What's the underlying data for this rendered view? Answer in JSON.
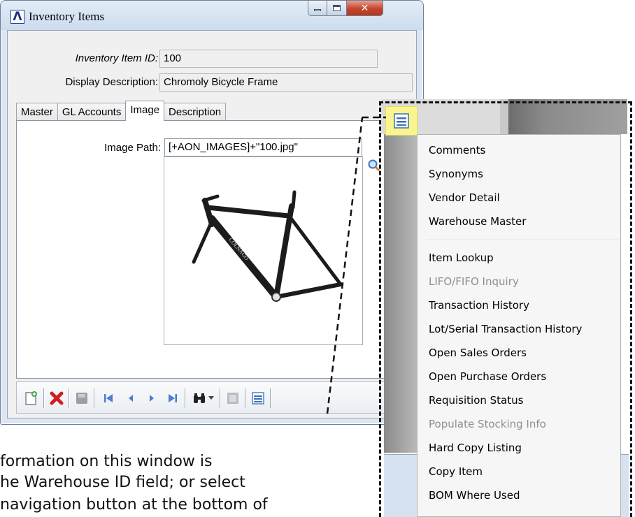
{
  "window": {
    "title": "Inventory Items",
    "app_icon_glyph": "Λ"
  },
  "form": {
    "item_id_label": "Inventory Item ID:",
    "item_id_value": "100",
    "description_label": "Display Description:",
    "description_value": "Chromoly Bicycle Frame"
  },
  "tabs": [
    {
      "label": "Master"
    },
    {
      "label": "GL Accounts"
    },
    {
      "label": "Image",
      "active": true
    },
    {
      "label": "Description"
    }
  ],
  "image_tab": {
    "path_label": "Image Path:",
    "path_value": "[+AON_IMAGES]+\"100.jpg\"",
    "frame_brand": "COLNAGO"
  },
  "toolbar": {
    "buttons": [
      "new-record-icon",
      "delete-icon",
      "save-icon",
      "first-record-icon",
      "previous-record-icon",
      "next-record-icon",
      "last-record-icon",
      "find-binoculars-icon",
      "dropdown-arrow-icon",
      "disabled-icon",
      "additional-options-icon"
    ]
  },
  "menu": {
    "items": [
      {
        "label": "Comments",
        "disabled": false
      },
      {
        "label": "Synonyms",
        "disabled": false
      },
      {
        "label": "Vendor Detail",
        "disabled": false
      },
      {
        "label": "Warehouse Master",
        "disabled": false
      },
      {
        "label": "Item Lookup",
        "disabled": false
      },
      {
        "label": "LIFO/FIFO Inquiry",
        "disabled": true
      },
      {
        "label": "Transaction History",
        "disabled": false
      },
      {
        "label": "Lot/Serial Transaction History",
        "disabled": false
      },
      {
        "label": "Open Sales Orders",
        "disabled": false
      },
      {
        "label": "Open Purchase Orders",
        "disabled": false
      },
      {
        "label": "Requisition Status",
        "disabled": false
      },
      {
        "label": "Populate Stocking Info",
        "disabled": true
      },
      {
        "label": "Hard Copy Listing",
        "disabled": false
      },
      {
        "label": "Copy Item",
        "disabled": false
      },
      {
        "label": "BOM Where Used",
        "disabled": false
      }
    ]
  },
  "doc_text": {
    "line1": "formation on this window is",
    "line2": "he Warehouse ID field; or select",
    "line3": "navigation button at the bottom of"
  },
  "colors": {
    "menu_button_highlight": "#fbf58e",
    "close_button": "#c6432b"
  }
}
